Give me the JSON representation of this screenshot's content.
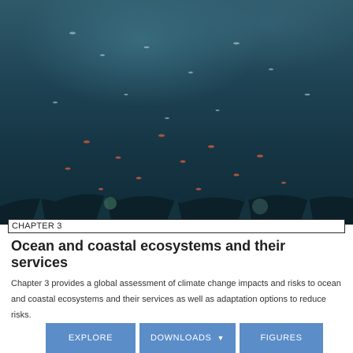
{
  "chapter": {
    "label": "CHAPTER 3",
    "title": "Ocean and coastal ecosystems and their services",
    "description": "Chapter 3 provides a global assessment of climate change impacts and risks to ocean and coastal ecosystems and their services as well as adaptation options to reduce risks."
  },
  "hero": {
    "icon": "ocean-reef-image",
    "colors": {
      "top": "#2f5a6a",
      "bottom": "#0f2a36"
    }
  },
  "actions": {
    "explore_label": "EXPLORE",
    "downloads_label": "DOWNLOADS",
    "downloads_icon": "chevron-down-icon",
    "figures_label": "FIGURES"
  },
  "colors": {
    "button": "#5b8dc9",
    "text": "#1f1f1f"
  }
}
